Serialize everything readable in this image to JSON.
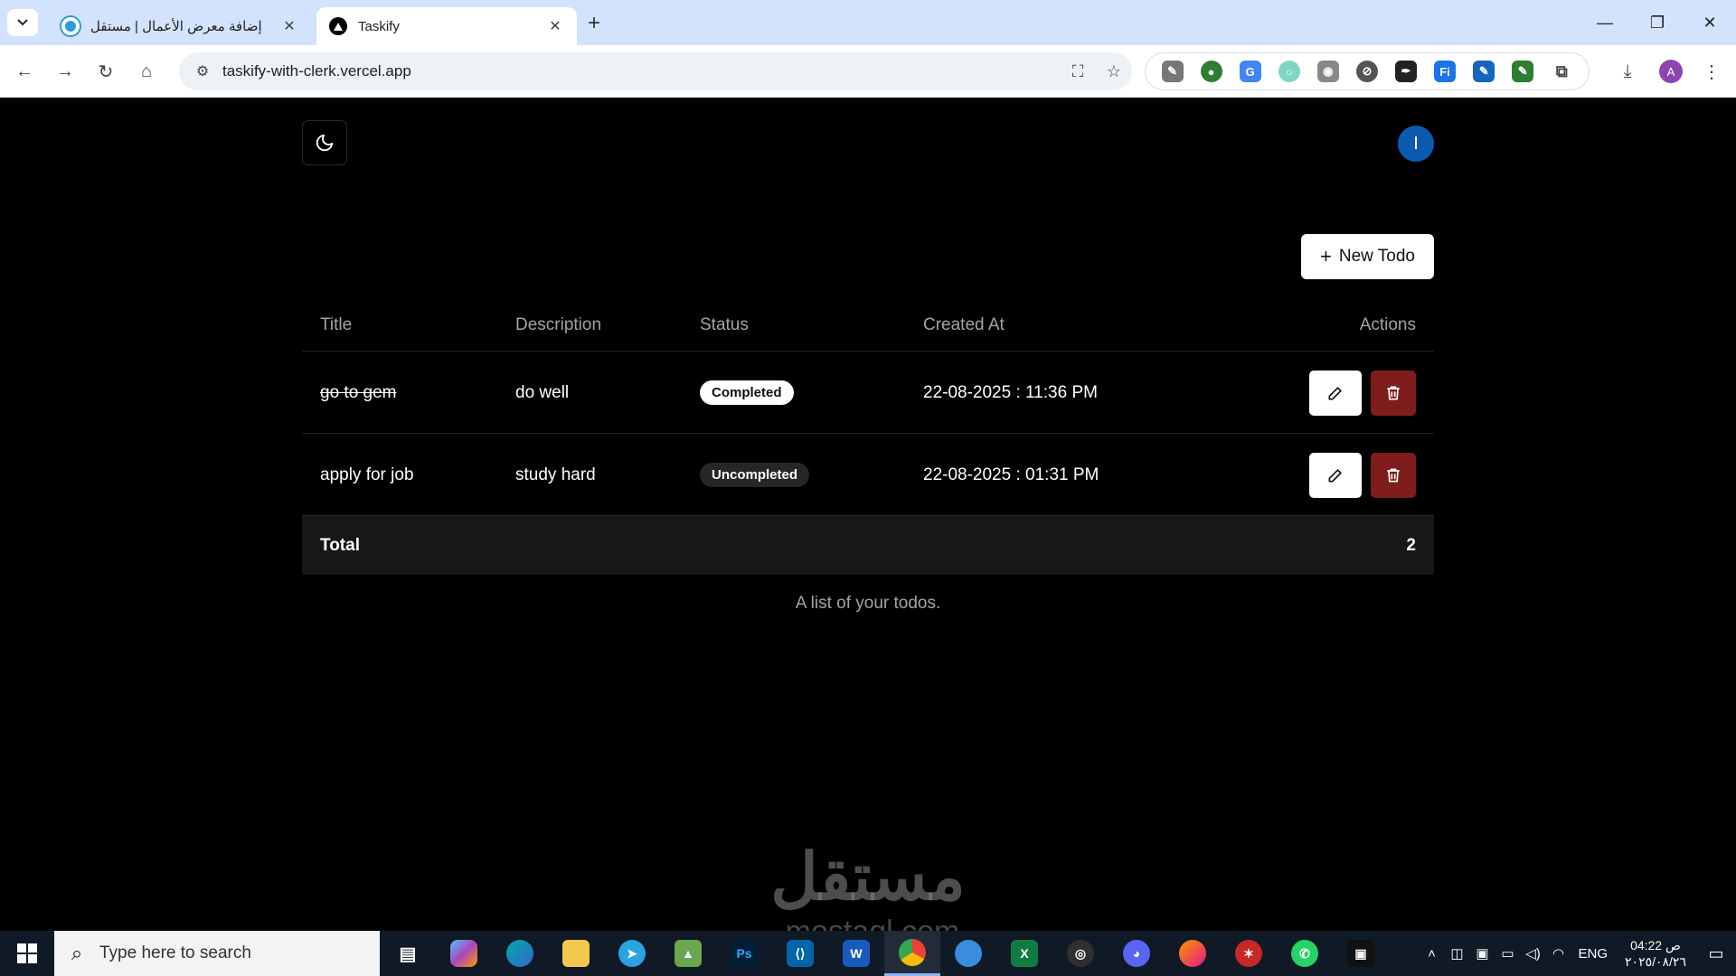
{
  "browser": {
    "tabs": [
      {
        "title": "إضافة معرض الأعمال | مستقل",
        "active": false
      },
      {
        "title": "Taskify",
        "active": true
      }
    ],
    "url": "taskify-with-clerk.vercel.app",
    "profile_initial": "A",
    "extensions": [
      "feather",
      "globe",
      "google-translate",
      "circle-ext",
      "camera",
      "block-ext",
      "pen-ext",
      "fi-ext",
      "pencil-ext",
      "marker-ext",
      "puzzle"
    ]
  },
  "app": {
    "avatar_initial": "I",
    "new_todo_label": "New Todo",
    "table": {
      "headers": {
        "title": "Title",
        "description": "Description",
        "status": "Status",
        "created_at": "Created At",
        "actions": "Actions"
      },
      "rows": [
        {
          "title": "go to gem",
          "description": "do well",
          "status": "Completed",
          "created_at": "22-08-2025 : 11:36 PM",
          "completed": true
        },
        {
          "title": "apply for job",
          "description": "study hard",
          "status": "Uncompleted",
          "created_at": "22-08-2025 : 01:31 PM",
          "completed": false
        }
      ],
      "footer": {
        "label": "Total",
        "value": "2"
      },
      "caption": "A list of your todos."
    },
    "colors": {
      "background": "#000000",
      "delete": "#7f1d1d",
      "avatar": "#0b5ab0"
    }
  },
  "watermark": {
    "main": "مستقل",
    "sub": "mostaql.com"
  },
  "taskbar": {
    "search_placeholder": "Type here to search",
    "apps": [
      "task-view",
      "copilot",
      "edge",
      "file-explorer",
      "telegram",
      "photo-app",
      "photoshop",
      "vscode",
      "word",
      "chrome",
      "lightbulb-app",
      "excel",
      "obs",
      "discord",
      "firefox",
      "security-app",
      "whatsapp",
      "package-app"
    ],
    "language": "ENG",
    "time": "04:22 ص",
    "date": "٢٠٢٥/٠٨/٢٦"
  }
}
